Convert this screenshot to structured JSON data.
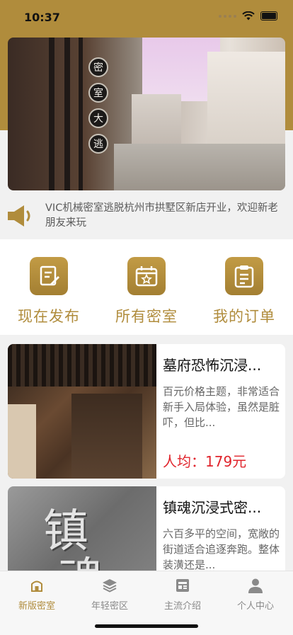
{
  "status_bar": {
    "time": "10:37"
  },
  "banner": {
    "sign_chars": [
      "密",
      "室",
      "大",
      "逃"
    ]
  },
  "notice": {
    "icon": "speaker-icon",
    "text": "VIC机械密室逃脱杭州市拱墅区新店开业，欢迎新老朋友来玩"
  },
  "menu": [
    {
      "label": "现在发布",
      "icon": "edit-document-icon"
    },
    {
      "label": "所有密室",
      "icon": "calendar-star-icon"
    },
    {
      "label": "我的订单",
      "icon": "clipboard-icon"
    }
  ],
  "rooms": [
    {
      "title": "墓府恐怖沉浸...",
      "desc": "百元价格主题，非常适合新手入局体验，虽然是脏吓，但比...",
      "price": "人均：179元"
    },
    {
      "title": "镇魂沉浸式密...",
      "desc": "六百多平的空间，宽敞的街道适合追逐奔跑。整体装潢还是...",
      "thumb_chars": [
        "镇",
        "魂"
      ]
    }
  ],
  "tabs": [
    {
      "label": "新版密室",
      "icon": "home-icon",
      "active": true
    },
    {
      "label": "年轻密区",
      "icon": "layers-icon",
      "active": false
    },
    {
      "label": "主流介绍",
      "icon": "news-icon",
      "active": false
    },
    {
      "label": "个人中心",
      "icon": "person-icon",
      "active": false
    }
  ],
  "colors": {
    "accent": "#b08c3c",
    "price": "#e0242c"
  }
}
